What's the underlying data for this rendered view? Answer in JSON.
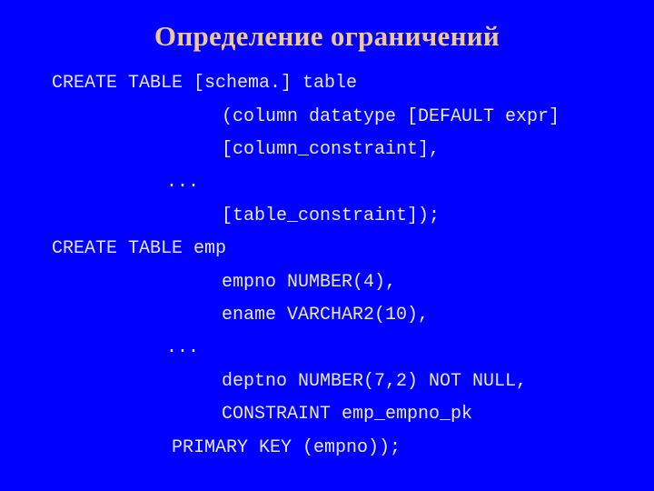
{
  "slide": {
    "title": "Определение ограничений",
    "background_color": "#0000FF",
    "title_color": "#F0C896",
    "code_color": "#E8E8F4",
    "code_lines": [
      "CREATE TABLE [schema.] table",
      "(column datatype [DEFAULT expr]",
      "[column_constraint],",
      "...",
      "[table_constraint]);",
      "CREATE TABLE emp",
      "empno NUMBER(4),",
      "ename VARCHAR2(10),",
      "...",
      "deptno NUMBER(7,2) NOT NULL,",
      "CONSTRAINT emp_empno_pk",
      "PRIMARY KEY (empno));"
    ]
  }
}
